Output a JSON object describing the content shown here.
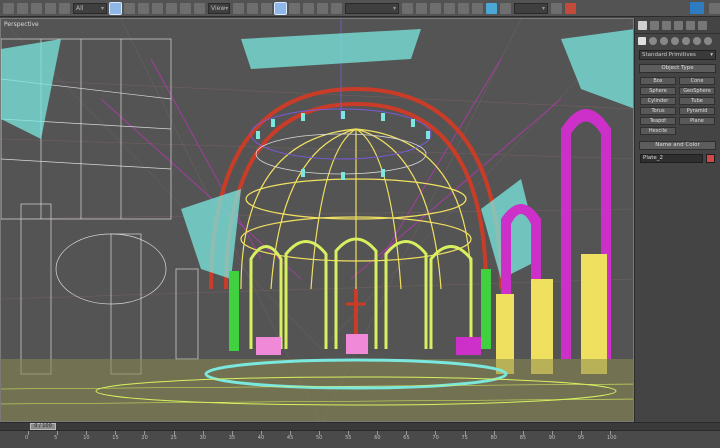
{
  "toolbar": {
    "selection_filter": "All",
    "view_dropdown": "View",
    "named_selection": "",
    "render_preset": "",
    "colors": {
      "accent_icon": "#4aa7d6",
      "active_icon": "#8fb8e8",
      "app_logo_bg": "#2e7bc0"
    }
  },
  "viewport": {
    "label": "Perspective",
    "colors": {
      "cyan": "#7be8e0",
      "lime": "#d8f060",
      "yellow": "#f0e060",
      "red": "#c83c28",
      "magenta": "#cc30c8",
      "white": "#d8d8d8",
      "purple": "#7a5ad8",
      "green": "#40d040",
      "pink": "#f08ad8"
    }
  },
  "command_panel": {
    "category": "Standard Primitives",
    "object_type_header": "Object Type",
    "object_buttons": [
      "Box",
      "Cone",
      "Sphere",
      "GeoSphere",
      "Cylinder",
      "Tube",
      "Torus",
      "Pyramid",
      "Teapot",
      "Plane",
      "Hexcile"
    ],
    "name_color_header": "Name and Color",
    "object_name": "Plate_2",
    "object_color": "#d04848"
  },
  "timeline": {
    "current_frame": "0 / 100",
    "ticks": [
      0,
      5,
      10,
      15,
      20,
      25,
      30,
      35,
      40,
      45,
      50,
      55,
      60,
      65,
      70,
      75,
      80,
      85,
      90,
      95,
      100
    ]
  }
}
